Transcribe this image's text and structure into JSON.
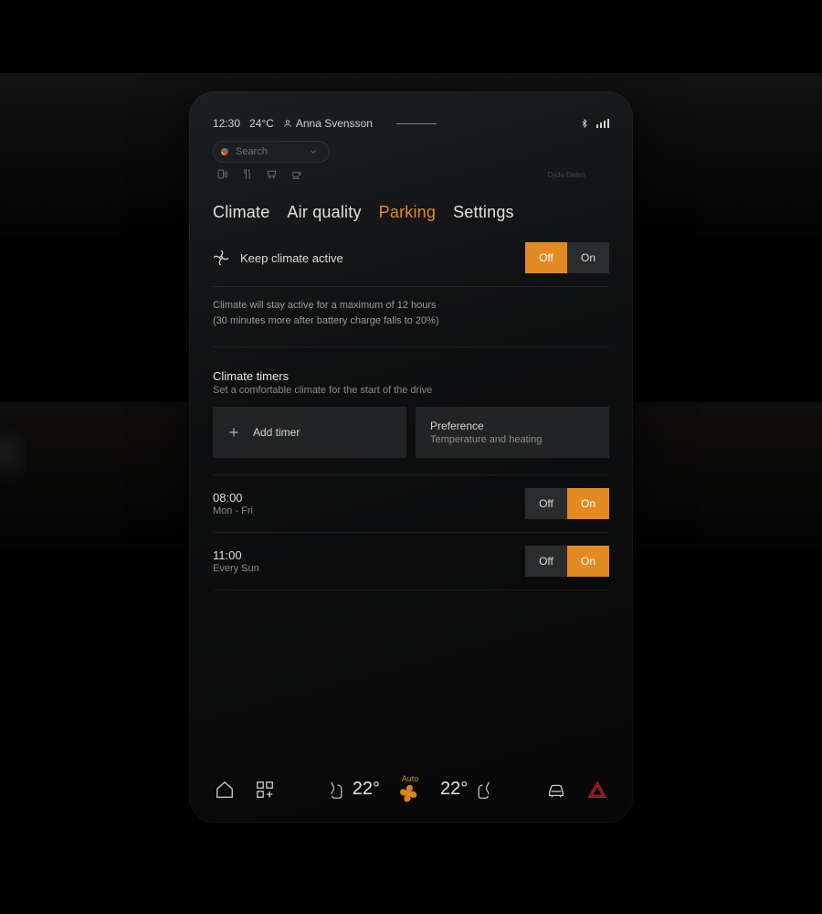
{
  "status": {
    "time": "12:30",
    "temp": "24°C",
    "user": "Anna Svensson"
  },
  "search": {
    "placeholder": "Search"
  },
  "map": {
    "label": "Djida Dalen"
  },
  "tabs": {
    "climate": "Climate",
    "air_quality": "Air quality",
    "parking": "Parking",
    "settings": "Settings"
  },
  "keep_climate": {
    "label": "Keep climate active",
    "off": "Off",
    "on": "On",
    "desc_line1": "Climate will stay active for a maximum of 12 hours",
    "desc_line2": "(30 minutes more after battery charge falls to 20%)"
  },
  "timers_section": {
    "title": "Climate timers",
    "subtitle": "Set a comfortable climate for the start of the drive",
    "add_label": "Add timer",
    "pref_title": "Preference",
    "pref_sub": "Temperature and heating"
  },
  "timers": [
    {
      "time": "08:00",
      "days": "Mon - Fri",
      "off": "Off",
      "on": "On"
    },
    {
      "time": "11:00",
      "days": "Every Sun",
      "off": "Off",
      "on": "On"
    }
  ],
  "bottom": {
    "auto": "Auto",
    "temp_left": "22°",
    "temp_right": "22°"
  }
}
